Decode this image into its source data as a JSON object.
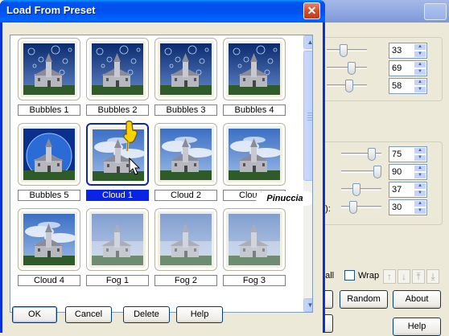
{
  "dialog": {
    "title": "Load From Preset",
    "presets": [
      {
        "name": "Bubbles 1",
        "effect": "bubbles",
        "selected": false
      },
      {
        "name": "Bubbles 2",
        "effect": "bubbles",
        "selected": false
      },
      {
        "name": "Bubbles 3",
        "effect": "bubbles",
        "selected": false
      },
      {
        "name": "Bubbles 4",
        "effect": "bubbles",
        "selected": false
      },
      {
        "name": "Bubbles 5",
        "effect": "globe",
        "selected": false
      },
      {
        "name": "Cloud 1",
        "effect": "cloud",
        "selected": true
      },
      {
        "name": "Cloud 2",
        "effect": "cloud",
        "selected": false
      },
      {
        "name": "Cloud 3",
        "effect": "cloud",
        "selected": false
      },
      {
        "name": "Cloud 4",
        "effect": "cloud",
        "selected": false
      },
      {
        "name": "Fog 1",
        "effect": "fog",
        "selected": false
      },
      {
        "name": "Fog 2",
        "effect": "fog",
        "selected": false
      },
      {
        "name": "Fog 3",
        "effect": "fog",
        "selected": false
      }
    ],
    "buttons": {
      "ok": "OK",
      "cancel": "Cancel",
      "delete": "Delete",
      "help": "Help"
    },
    "watermark": "Pinuccia"
  },
  "background_dialog": {
    "group1_values": [
      "33",
      "69",
      "58"
    ],
    "group1_levels": [
      0.42,
      0.62,
      0.56
    ],
    "group2_values": [
      "75",
      "90",
      "37",
      "30"
    ],
    "group2_levels": [
      0.75,
      0.9,
      0.37,
      0.3
    ],
    "param_label_fragment": "0):",
    "reset_all_fragment": "t all",
    "wrap_label": "Wrap",
    "random_label": "Random",
    "about_label": "About",
    "help_label": "Help"
  },
  "colors": {
    "title_bar": "#0050ee",
    "selection": "#0a24e6",
    "close_button": "#d0512d"
  }
}
